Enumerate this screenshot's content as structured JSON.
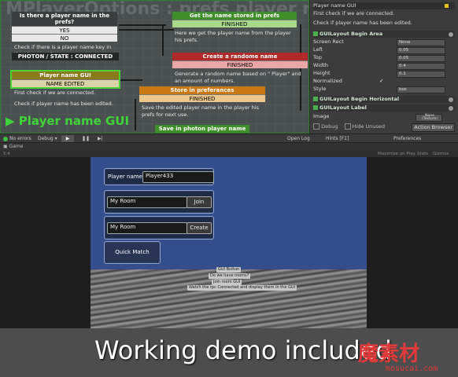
{
  "graph": {
    "watermark_title": "MPlayerOptions : prefs player name to",
    "big_label": "Player name GUI",
    "states": [
      {
        "title": "Is there a player name in the prefs?",
        "rows": [
          "YES",
          "NO"
        ],
        "desc": "Check if there is a player name key in the player preferences."
      },
      {
        "title": "Get the name stored in prefs",
        "rows": [
          "FINISHED"
        ],
        "desc": "Here we get the player name from the player his prefs."
      },
      {
        "title": "PHOTON / STATE : CONNECTED",
        "rows": [],
        "desc": ""
      },
      {
        "title": "Create a randome name",
        "rows": [
          "FINISHED"
        ],
        "desc": "Generate a random name based on \" Player\" and an amount of numbers."
      },
      {
        "title": "Player name GUI",
        "rows": [
          "NAME EDITED"
        ],
        "desc": "First check if we are connected.",
        "desc2": "Check if player name has been edited."
      },
      {
        "title": "Store in preferances",
        "rows": [
          "FINISHED"
        ],
        "desc": "Save the edited player name in the player his prefs for next use."
      },
      {
        "title": "Save in photon player name",
        "rows": [],
        "desc": ""
      }
    ]
  },
  "inspector": {
    "title": "Player name GUI",
    "desc1": "First check if we are connected.",
    "desc2": "Check if player name has been edited.",
    "sections": {
      "area": "GUILayout Begin Area",
      "horizontal": "GUILayout Begin Horizontal",
      "label": "GUILayout Label"
    },
    "fields": [
      {
        "label": "Screen Rect",
        "value": "None"
      },
      {
        "label": "Left",
        "value": "0.05"
      },
      {
        "label": "Top",
        "value": "0.05"
      },
      {
        "label": "Width",
        "value": "0.4"
      },
      {
        "label": "Height",
        "value": "0.1"
      },
      {
        "label": "Normalized",
        "value": "✓"
      },
      {
        "label": "Style",
        "value": "box"
      }
    ],
    "image_label": "Image",
    "image_value": "None (Texture)",
    "debug_label": "Debug",
    "hide_unused_label": "Hide Unused",
    "action_browser": "Action Browser"
  },
  "toolbar": {
    "errors": "No errors",
    "debug": "Debug",
    "open_log": "Open Log",
    "hints": "Hints [F1]",
    "preferences": "Preferences"
  },
  "game_tab": {
    "tab_label": "Game",
    "aspect": "5:4",
    "maximize": "Maximize on Play",
    "stats": "Stats",
    "gizmos": "Gizmos"
  },
  "game_gui": {
    "player_name_label": "Player name:",
    "player_name_value": "Player433",
    "join_room_value": "My Room",
    "join_button": "Join",
    "create_room_value": "My Room",
    "create_button": "Create",
    "quick_match": "Quick Match"
  },
  "tooltips": [
    "GUI Button",
    "Do we have rooms?",
    "Join room GUI",
    "Watch the rpc Connected and display them in the GUI"
  ],
  "banner": {
    "text": "Working demo included",
    "watermark": "魔素材",
    "watermark_sub": "mosucai.com"
  },
  "colors": {
    "accent_green": "#3f8f28",
    "state_red": "#b02a2a",
    "state_orange": "#c87914",
    "game_bg": "#344d8c"
  }
}
